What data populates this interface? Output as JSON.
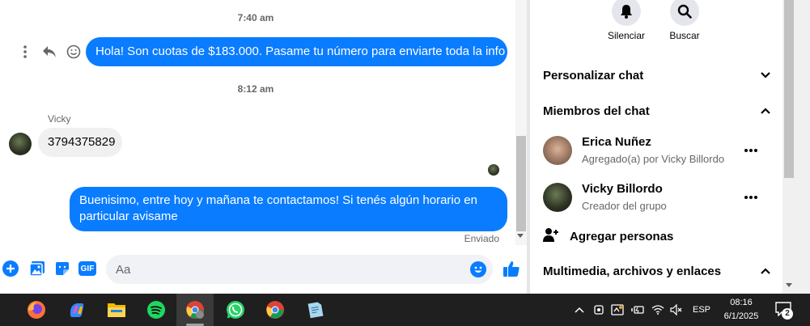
{
  "conversation": {
    "timestamps": [
      "7:40 am",
      "8:12 am"
    ],
    "messages": [
      {
        "direction": "out",
        "text": "Hola! Son cuotas de $183.000. Pasame tu número para enviarte toda la info"
      },
      {
        "direction": "in",
        "sender": "Vicky",
        "text": "3794375829"
      },
      {
        "direction": "out",
        "text": "Buenisimo, entre hoy y mañana te contactamos! Si tenés algún horario en particular avisame"
      }
    ],
    "status": "Enviado"
  },
  "composer": {
    "placeholder": "Aa",
    "gif_label": "GIF"
  },
  "panel": {
    "actions": [
      {
        "label": "Silenciar",
        "icon": "bell-icon"
      },
      {
        "label": "Buscar",
        "icon": "search-icon"
      }
    ],
    "sections": {
      "customize": "Personalizar chat",
      "members": "Miembros del chat",
      "media": "Multimedia, archivos y enlaces"
    },
    "members": [
      {
        "name": "Erica Nuñez",
        "subtitle": "Agregado(a) por Vicky Billordo"
      },
      {
        "name": "Vicky Billordo",
        "subtitle": "Creador del grupo"
      }
    ],
    "add_people": "Agregar personas"
  },
  "taskbar": {
    "apps": [
      "firefox",
      "copilot",
      "file-explorer",
      "spotify",
      "chrome",
      "whatsapp",
      "chrome",
      "notepad"
    ],
    "language": "ESP",
    "time": "08:16",
    "date": "6/1/2025",
    "notifications": "2"
  },
  "colors": {
    "accent": "#0a7cff",
    "incoming_bubble": "#f0f0f0",
    "taskbar": "#1f1f1f"
  }
}
